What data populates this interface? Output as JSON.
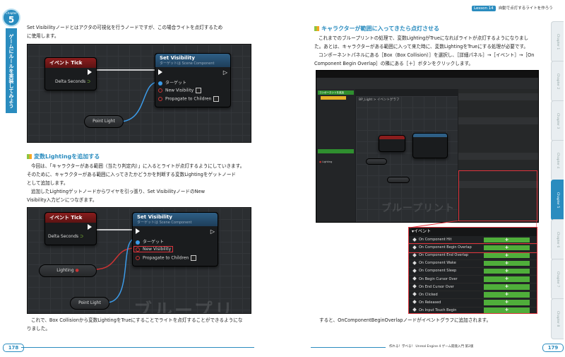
{
  "chapter": {
    "label": "Chapter",
    "number": "5",
    "strip_title": "ゲームにルールを実装してみよう"
  },
  "lesson": {
    "tag": "Lesson 14",
    "title": "自動で点灯するライトを作ろう"
  },
  "left": {
    "intro": [
      "Set Visibilityノードとはアクタの可視化を行うノードですが、この場合ライトを点灯するため",
      "に使用します。"
    ],
    "graph1": {
      "event_tick": "イベント Tick",
      "delta_seconds": "Delta Seconds",
      "set_visibility": "Set Visibility",
      "set_visibility_sub": "ターゲットは Scene Component",
      "target": "ターゲット",
      "new_visibility": "New Visibility",
      "propagate": "Propagate to Children",
      "point_light": "Point Light"
    },
    "section_title": "変数Lightingを追加する",
    "para1": [
      "今回は、「キャラクターがある範囲（当たり判定内）」に入るとライトが点灯するようにしていきます。",
      "そのために、キャラクターがある範囲に入ってきたかどうかを判断する変数Lightingをゲットノード",
      "として追加します。"
    ],
    "para2": [
      "追加したLightingゲットノードからワイヤを引っ張り、Set VisibilityノードのNew",
      "Visibility入力ピンにつなぎます。"
    ],
    "graph2": {
      "event_tick": "イベント Tick",
      "delta_seconds": "Delta Seconds",
      "set_visibility": "Set Visibility",
      "set_visibility_sub": "ターゲットは Scene Component",
      "target": "ターゲット",
      "new_visibility": "New Visibility",
      "propagate": "Propagate to Children",
      "lighting": "Lighting",
      "point_light": "Point Light",
      "watermark": "ブループリン"
    },
    "outro": [
      "これで、Box Collisionから変数LightingをTrueにすることでライトを点灯することができるようにな",
      "りました。"
    ]
  },
  "right": {
    "section_title": "キャラクターが範囲に入ってきたら点灯させる",
    "para": [
      "これまでのブループリントの処理で、変数LightingがTrueになればライトが点灯するようになりまし",
      "た。あとは、キャラクターがある範囲に入って来た時に、変数LightingをTrueにする処理が必要です。",
      "コンポーネントパネルにある［Box（Box Collision）］を選択し、［詳細パネル］→［イベント］→［On",
      "Component Begin Overlap］の隣にある［＋］ボタンをクリックします。"
    ],
    "ue": {
      "tab_event_graph": "BP_Light > イベントグラフ",
      "watermark": "ブループリント",
      "components_label": "コンポーネントを追加",
      "lighting": "Lighting",
      "point_light": "Point Light",
      "events_header": "イベント",
      "events": [
        "On Component Hit",
        "On Component Begin Overlap",
        "On Component End Overlap",
        "On Component Wake",
        "On Component Sleep",
        "On Begin Cursor Over",
        "On End Cursor Over",
        "On Clicked",
        "On Released",
        "On Input Touch Begin"
      ],
      "plus": "+"
    },
    "closing": "すると、OnComponentBeginOverlapノードがイベントグラフに追加されます。"
  },
  "tabs": [
    "Chapter 1",
    "Chapter 2",
    "Chapter 3",
    "Chapter 4",
    "Chapter 5",
    "Chapter 6",
    "Chapter 7",
    "Chapter 8"
  ],
  "footer": {
    "left_page": "178",
    "right_page": "179",
    "book": "作れる！学べる！ Unreal Engine 4 ゲーム開発入門 第2版"
  }
}
